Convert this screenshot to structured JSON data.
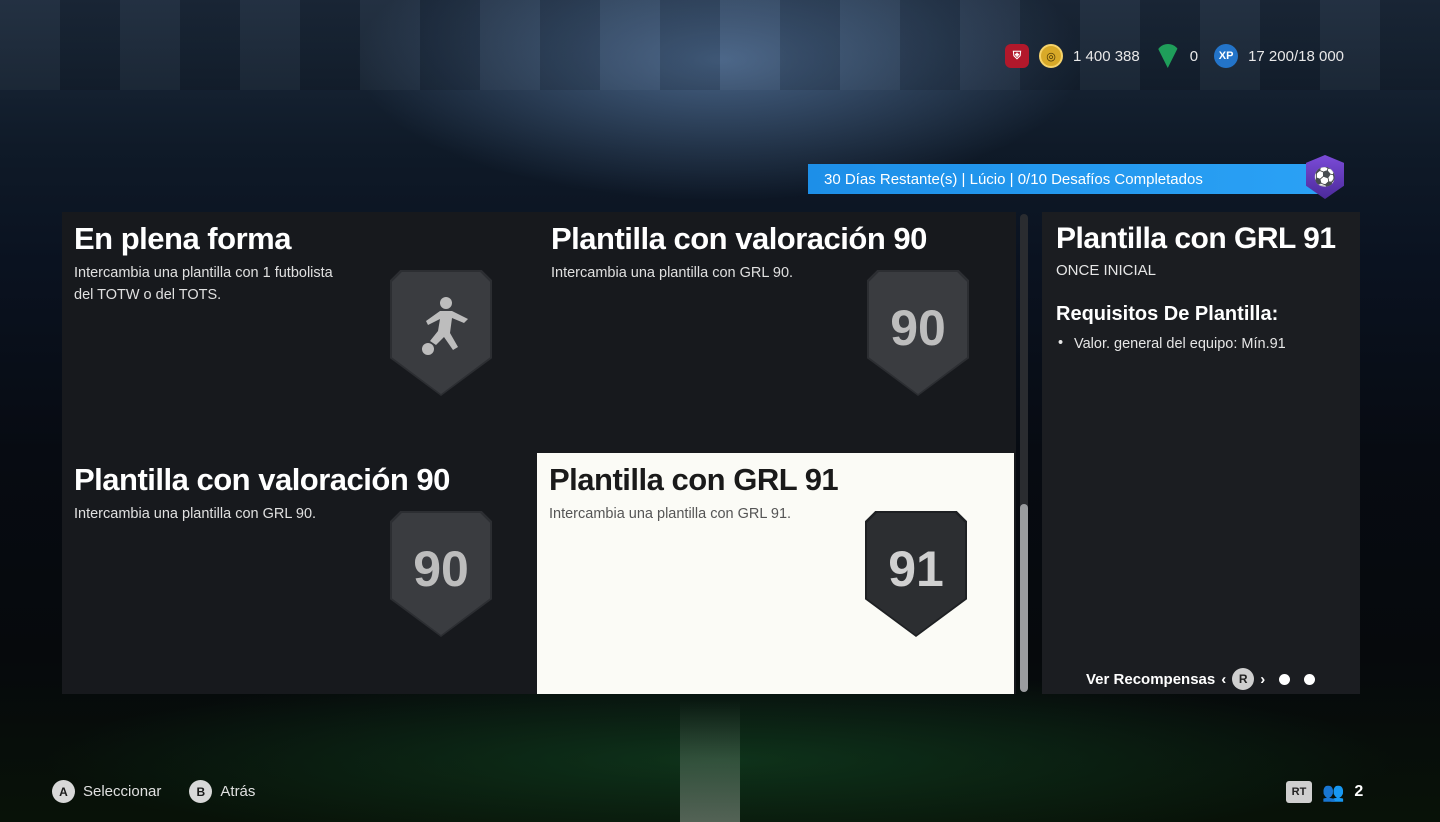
{
  "currency": {
    "coins": "1 400 388",
    "points": "0",
    "xp": "17 200/18 000",
    "club_icon": "club-crest-icon",
    "coin_icon": "coin-icon",
    "points_icon": "fc-points-icon",
    "xp_icon": "xp-icon"
  },
  "season_banner": "30 Días Restante(s) | Lúcio | 0/10 Desafíos Completados",
  "challenges": [
    {
      "title": "En plena forma",
      "description": "Intercambia una plantilla con 1 futbolista del TOTW o del TOTS.",
      "badge_icon": "player-kicking-icon"
    },
    {
      "title": "Plantilla con valoración 90",
      "description": "Intercambia una plantilla con GRL 90.",
      "badge": "90"
    },
    {
      "title": "Plantilla con valoración 90",
      "description": "Intercambia una plantilla con GRL 90.",
      "badge": "90"
    },
    {
      "title": "Plantilla con GRL 91",
      "description": "Intercambia una plantilla con GRL 91.",
      "badge": "91",
      "selected": true
    }
  ],
  "detail": {
    "title": "Plantilla con GRL 91",
    "subtitle": "ONCE INICIAL",
    "requirements_title": "Requisitos De Plantilla:",
    "requirements": [
      "Valor. general del equipo: Mín.91"
    ],
    "rewards_label": "Ver Recompensas",
    "rewards_button": "R"
  },
  "footer": {
    "select_button": "A",
    "select_label": "Seleccionar",
    "back_button": "B",
    "back_label": "Atrás",
    "rt_button": "RT",
    "friends_count": "2"
  },
  "colors": {
    "banner": "#1d8fe8",
    "selected_card": "#fbfbf6",
    "card_bg": "#17191d"
  }
}
